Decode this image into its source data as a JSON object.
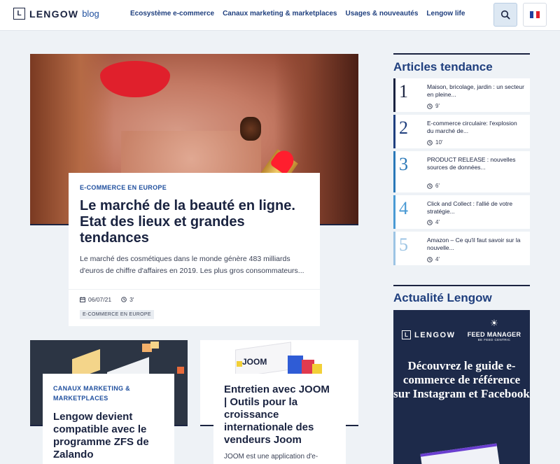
{
  "header": {
    "logo_letter": "L",
    "logo_word": "LENGOW",
    "logo_suffix": "blog",
    "nav": [
      "Ecosystème e-commerce",
      "Canaux marketing & marketplaces",
      "Usages & nouveautés",
      "Lengow life"
    ],
    "search_icon": "search-icon",
    "language_icon": "french-flag-icon",
    "flag_colors": [
      "#1f3f9e",
      "#ffffff",
      "#e0202c"
    ]
  },
  "hero": {
    "category": "E-COMMERCE EN EUROPE",
    "title": "Le marché de la beauté en ligne. Etat des lieux et grandes tendances",
    "excerpt": "Le marché des cosmétiques dans le monde génère 483 milliards d'euros de chiffre d'affaires en 2019. Les plus gros consommateurs...",
    "date": "06/07/21",
    "read_time": "3'",
    "tag": "E-COMMERCE EN EUROPE"
  },
  "cards": [
    {
      "category": "CANAUX MARKETING & MARKETPLACES",
      "title": "Lengow devient compatible avec le programme ZFS de Zalando"
    },
    {
      "image_text": "JOOM",
      "title": "Entretien avec JOOM | Outils pour la croissance internationale des vendeurs Joom",
      "excerpt": "JOOM est une application d'e-"
    }
  ],
  "sidebar": {
    "trending_heading": "Articles tendance",
    "trending": [
      {
        "rank": "1",
        "title": "Maison, bricolage, jardin : un secteur en pleine...",
        "time": "9'"
      },
      {
        "rank": "2",
        "title": "E-commerce circulaire: l'explosion du marché de...",
        "time": "10'"
      },
      {
        "rank": "3",
        "title": "PRODUCT RELEASE : nouvelles sources de données...",
        "time": "6'"
      },
      {
        "rank": "4",
        "title": "Click and Collect : l'allié de votre stratégie...",
        "time": "4'"
      },
      {
        "rank": "5",
        "title": "Amazon – Ce qu'il faut savoir sur la nouvelle...",
        "time": "4'"
      }
    ],
    "rank_colors": [
      "#1a2340",
      "#1f3f7e",
      "#2a78b8",
      "#4a9ad4",
      "#9cc4e4"
    ],
    "news_heading": "Actualité Lengow",
    "promo": {
      "logo_letter": "L",
      "logo_word": "LENGOW",
      "feed_manager": "FEED MANAGER",
      "feed_sub": "BE FEED CENTRIC",
      "title": "Découvrez le guide e-commerce de référence sur Instagram et Facebook"
    }
  }
}
